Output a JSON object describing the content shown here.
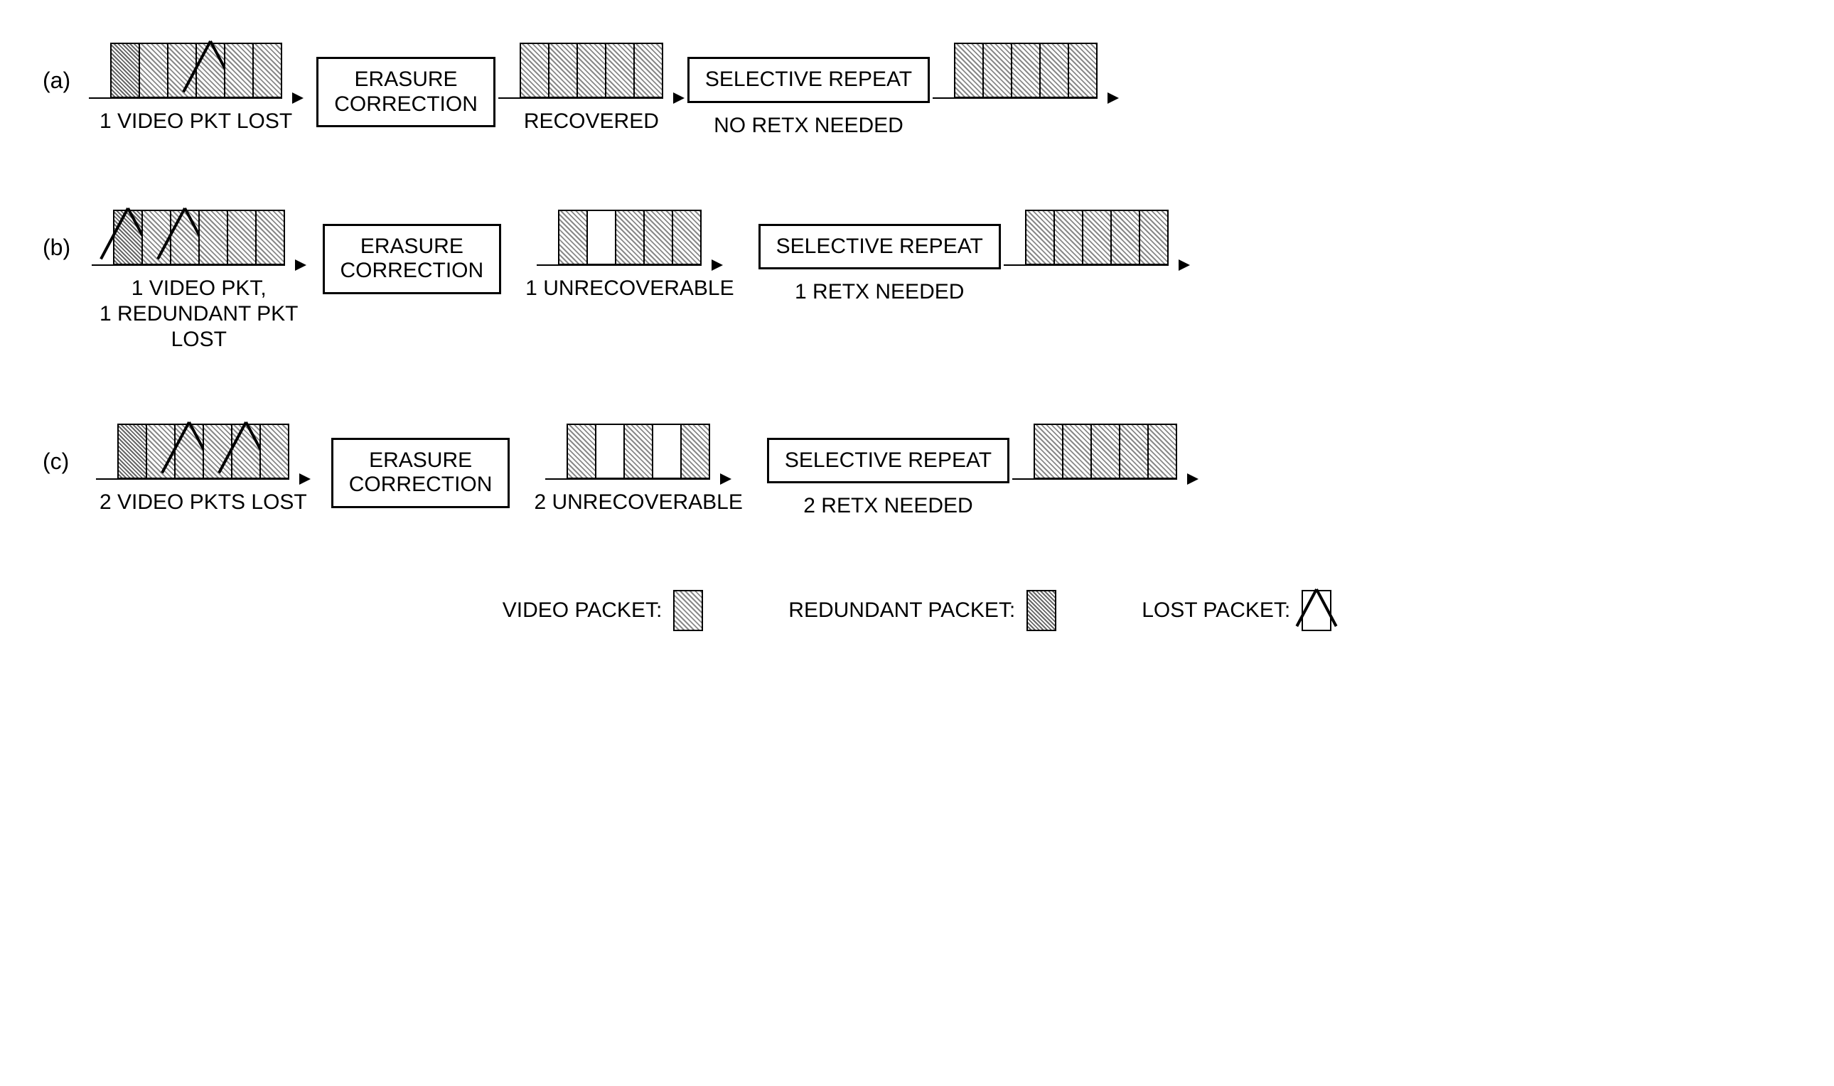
{
  "rows": [
    {
      "label": "(a)",
      "stage1": {
        "packets": [
          "cross-hatch",
          "hatch",
          "hatch",
          "hatch lost",
          "hatch",
          "hatch"
        ],
        "caption": "1 VIDEO PKT LOST"
      },
      "erasure": "ERASURE\nCORRECTION",
      "stage2": {
        "packets": [
          "hatch",
          "hatch",
          "hatch",
          "hatch",
          "hatch"
        ],
        "caption": "RECOVERED"
      },
      "selective": "SELECTIVE REPEAT",
      "sel_caption": "NO RETX NEEDED",
      "stage3": {
        "packets": [
          "hatch",
          "hatch",
          "hatch",
          "hatch",
          "hatch"
        ]
      }
    },
    {
      "label": "(b)",
      "stage1": {
        "packets": [
          "cross-hatch lost",
          "hatch",
          "hatch lost",
          "hatch",
          "hatch",
          "hatch"
        ],
        "caption": "1 VIDEO PKT,\n1 REDUNDANT PKT\nLOST"
      },
      "erasure": "ERASURE\nCORRECTION",
      "stage2": {
        "packets": [
          "hatch",
          "empty",
          "hatch",
          "hatch",
          "hatch"
        ],
        "caption": "1 UNRECOVERABLE"
      },
      "selective": "SELECTIVE REPEAT",
      "sel_caption": "1 RETX NEEDED",
      "stage3": {
        "packets": [
          "hatch",
          "hatch",
          "hatch",
          "hatch",
          "hatch"
        ]
      }
    },
    {
      "label": "(c)",
      "stage1": {
        "packets": [
          "cross-hatch",
          "hatch",
          "hatch lost",
          "hatch",
          "hatch lost",
          "hatch"
        ],
        "caption": "2 VIDEO PKTS LOST"
      },
      "erasure": "ERASURE\nCORRECTION",
      "stage2": {
        "packets": [
          "hatch",
          "empty",
          "hatch",
          "empty",
          "hatch"
        ],
        "caption": "2 UNRECOVERABLE"
      },
      "selective": "SELECTIVE REPEAT",
      "sel_caption": "2 RETX NEEDED",
      "stage3": {
        "packets": [
          "hatch",
          "hatch",
          "hatch",
          "hatch",
          "hatch"
        ]
      }
    }
  ],
  "legend": {
    "video": "VIDEO PACKET:",
    "redundant": "REDUNDANT PACKET:",
    "lost": "LOST PACKET:"
  }
}
